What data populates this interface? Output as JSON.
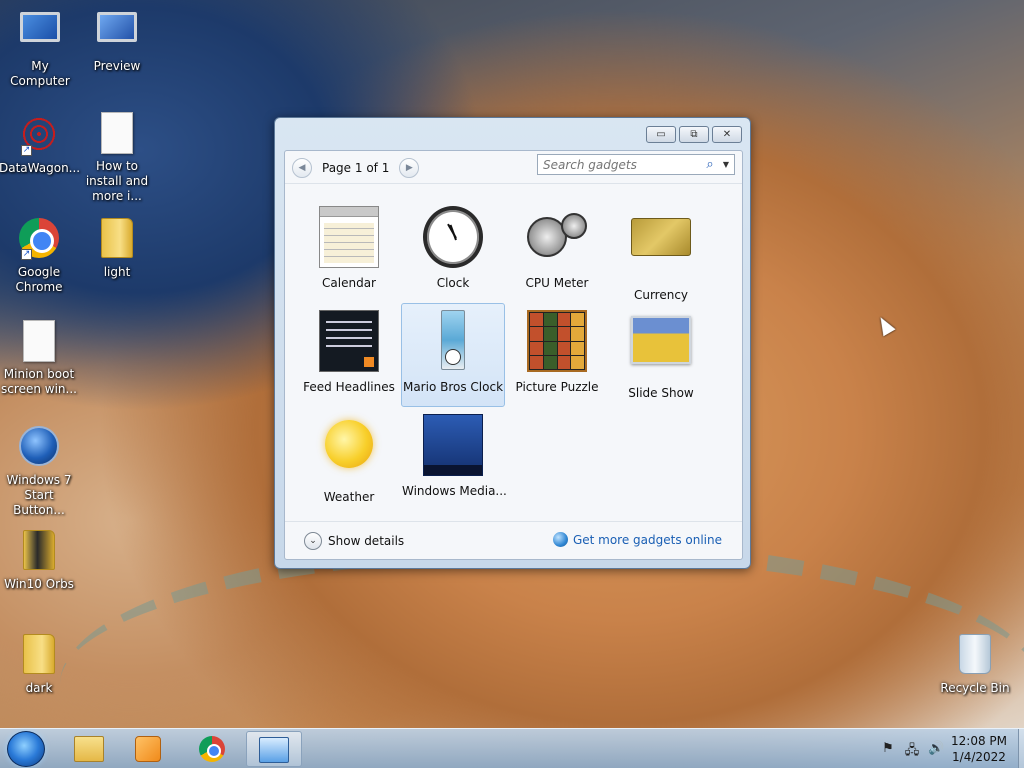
{
  "desktop": {
    "icons": [
      {
        "label": "My Computer"
      },
      {
        "label": "Preview"
      },
      {
        "label": "DataWagon..."
      },
      {
        "label": "How to install and more i..."
      },
      {
        "label": "Google Chrome"
      },
      {
        "label": "light"
      },
      {
        "label": "Minion boot screen win..."
      },
      {
        "label": "Windows 7 Start Button..."
      },
      {
        "label": "Win10 Orbs"
      },
      {
        "label": "dark"
      },
      {
        "label": "Recycle Bin"
      }
    ]
  },
  "gadget_window": {
    "controls": {
      "minimize": "▭",
      "restore": "⧉",
      "close": "✕"
    },
    "pager": {
      "prev": "◀",
      "label": "Page 1 of 1",
      "next": "▶"
    },
    "search": {
      "placeholder": "Search gadgets",
      "icon": "⌕",
      "dropdown": "▼"
    },
    "gadgets": [
      {
        "label": "Calendar"
      },
      {
        "label": "Clock"
      },
      {
        "label": "CPU Meter"
      },
      {
        "label": "Currency"
      },
      {
        "label": "Feed Headlines"
      },
      {
        "label": "Mario Bros Clock",
        "selected": true
      },
      {
        "label": "Picture Puzzle"
      },
      {
        "label": "Slide Show"
      },
      {
        "label": "Weather"
      },
      {
        "label": "Windows Media..."
      }
    ],
    "footer": {
      "show_details": "Show details",
      "show_details_chevron": "⌄",
      "more_online": "Get more gadgets online"
    }
  },
  "taskbar": {
    "clock": {
      "time": "12:08 PM",
      "date": "1/4/2022"
    },
    "tray": {
      "flag": "⚑",
      "network": "🖧",
      "volume": "🔊"
    }
  },
  "colors": {
    "link": "#1a5fb4",
    "selection": "#d3e4f7"
  }
}
